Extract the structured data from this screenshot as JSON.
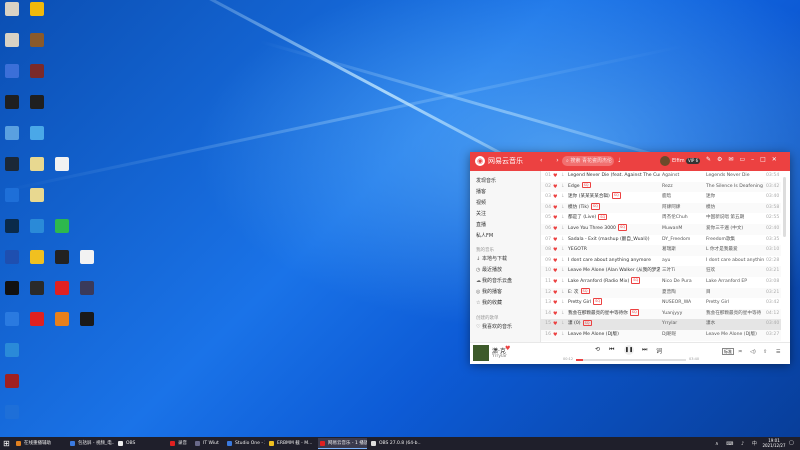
{
  "desktop": {
    "icons": [
      {
        "label": "",
        "color": "#d9d2c4"
      },
      {
        "label": "",
        "color": "#f0b90b"
      },
      {
        "label": "",
        "color": "#d9d2c4"
      },
      {
        "label": "",
        "color": "#8a5a2b"
      },
      {
        "label": "",
        "color": "#3b6fd8"
      },
      {
        "label": "",
        "color": "#7a2a2a"
      },
      {
        "label": "",
        "color": "#1f1f1f"
      },
      {
        "label": "",
        "color": "#1f1f1f"
      },
      {
        "label": "",
        "color": "#5aa0e0"
      },
      {
        "label": "",
        "color": "#4aa8e8"
      },
      {
        "label": "",
        "color": "#1b2838"
      },
      {
        "label": "",
        "color": "#e8d890"
      },
      {
        "label": "",
        "color": "#f2f2f2"
      },
      {
        "label": "",
        "color": "#1e6fd8"
      },
      {
        "label": "",
        "color": "#e8d890"
      },
      {
        "label": "",
        "color": "#0a2a4a"
      },
      {
        "label": "",
        "color": "#2a8ad8"
      },
      {
        "label": "",
        "color": "#2db84d"
      },
      {
        "label": "",
        "color": "#1e4fb0"
      },
      {
        "label": "",
        "color": "#f0c020"
      },
      {
        "label": "",
        "color": "#222222"
      },
      {
        "label": "",
        "color": "#f2f2f2"
      },
      {
        "label": "",
        "color": "#111111"
      },
      {
        "label": "",
        "color": "#2a2a2a"
      },
      {
        "label": "",
        "color": "#e02020"
      },
      {
        "label": "",
        "color": "#3a3a5a"
      },
      {
        "label": "",
        "color": "#2a7ae0"
      },
      {
        "label": "",
        "color": "#e02020"
      },
      {
        "label": "",
        "color": "#e8801a"
      },
      {
        "label": "",
        "color": "#1a1a1a"
      },
      {
        "label": "",
        "color": "#2a8ad8"
      },
      {
        "label": "",
        "color": "#a02020"
      },
      {
        "label": "",
        "color": "#1e6fd8"
      }
    ]
  },
  "app": {
    "title": "网易云音乐",
    "search_placeholder": "搜索 青花瓷周杰伦",
    "username": "Elfim",
    "vip": "VIP 6",
    "accent": "#ec4141",
    "sidebar": {
      "items": [
        "发现音乐",
        "播客",
        "视频",
        "关注",
        "直播",
        "私人FM"
      ],
      "section_mine": "我的音乐",
      "my_items": [
        {
          "icon": "download-icon",
          "glyph": "↓",
          "label": "本地与下载"
        },
        {
          "icon": "clock-icon",
          "glyph": "◷",
          "label": "最近播放"
        },
        {
          "icon": "cloud-icon",
          "glyph": "☁",
          "label": "我的音乐云盘"
        },
        {
          "icon": "podcast-icon",
          "glyph": "◎",
          "label": "我的播客"
        },
        {
          "icon": "star-icon",
          "glyph": "☆",
          "label": "我的收藏"
        }
      ],
      "section_playlists": "创建的歌单",
      "liked": "我喜欢的音乐"
    },
    "songs": [
      {
        "num": "01",
        "title": "Legend Never Die (feat. Against The Current)",
        "tag": "",
        "artist": "Against",
        "album": "Legends Never Die",
        "dur": "03:54"
      },
      {
        "num": "02",
        "title": "Edge",
        "tag": "SQ",
        "artist": "Rezz",
        "album": "The Silence Is Deafening",
        "dur": "03:42"
      },
      {
        "num": "03",
        "title": "迷你 (某某某某合辑)",
        "tag": "SQ",
        "artist": "鹿晗",
        "album": "迷你",
        "dur": "03:40"
      },
      {
        "num": "04",
        "title": "模仿 (Tik)",
        "tag": "SQ",
        "artist": "阿肆阿肆",
        "album": "模仿",
        "dur": "03:58"
      },
      {
        "num": "05",
        "title": "都是了 (Live)",
        "tag": "SQ",
        "artist": "周杰伦Chuh",
        "album": "中国新说唱 第五期",
        "dur": "02:55"
      },
      {
        "num": "06",
        "title": "Love You Three 3000",
        "tag": "SQ",
        "artist": "MuwanM",
        "album": "爱你三千遍 (中文)",
        "dur": "02:40"
      },
      {
        "num": "07",
        "title": "Sadala - Exit (mashup (翻自_Wuali))",
        "tag": "",
        "artist": "DY_Freedom",
        "album": "Freedom歌集",
        "dur": "03:35"
      },
      {
        "num": "08",
        "title": "YEGOTR",
        "tag": "",
        "artist": "葛瑞斯",
        "album": "L 你才是我最爱",
        "dur": "03:10"
      },
      {
        "num": "09",
        "title": "I dont care about anything anymore",
        "tag": "",
        "artist": "ayu",
        "album": "I dont care about anything a",
        "dur": "02:28"
      },
      {
        "num": "10",
        "title": "Leave Me Alone (Alan Walker (从我的梦游))",
        "tag": "",
        "artist": "三叶Ti",
        "album": "狂欢",
        "dur": "03:21"
      },
      {
        "num": "11",
        "title": "Lake Arranford (Radio Mix)",
        "tag": "SQ",
        "artist": "Nico De Pura",
        "album": "Lake Arranford EP",
        "dur": "03:08"
      },
      {
        "num": "12",
        "title": "E: 次",
        "tag": "SQ",
        "artist": "夏普陶",
        "album": "目",
        "dur": "03:21"
      },
      {
        "num": "13",
        "title": "Pretty Girl",
        "tag": "SQ",
        "artist": "NUSEOR_WA",
        "album": "Pretty Girl",
        "dur": "03:42"
      },
      {
        "num": "14",
        "title": "我会在那颗最亮的星中等待你",
        "tag": "SQ",
        "artist": "Yuanjyyy",
        "album": "我会在那颗最亮的星中等待",
        "dur": "04:12"
      },
      {
        "num": "15",
        "title": "潇 (0)",
        "tag": "SQ",
        "artist": "Yrrylar",
        "album": "潇水",
        "dur": "03:40"
      },
      {
        "num": "16",
        "title": "Leave Me Alone (DJ版)",
        "tag": "",
        "artist": "DJ呢呢",
        "album": "Leave Me Alone (DJ版)",
        "dur": "03:27"
      }
    ],
    "active_row": 14,
    "player": {
      "title": "潇·克",
      "artist": "Yrrylar",
      "current": "00:12",
      "total": "03:40",
      "progress": 0.06,
      "quality": "标准",
      "lyric": "词"
    }
  },
  "taskbar": {
    "start": "⊞",
    "apps": [
      {
        "label": "在线重播辅助",
        "color": "#e08020"
      },
      {
        "label": "包括屏 - 视频_电...",
        "color": "#3a7ae0"
      },
      {
        "label": "OBS",
        "color": "#eeeeee"
      },
      {
        "label": "录音",
        "color": "#e02020"
      },
      {
        "label": "IT Wiut",
        "color": "#6a6a8a"
      },
      {
        "label": "Studio One - 202...",
        "color": "#3a7ae0"
      },
      {
        "label": "ERBMM 截 - M...",
        "color": "#f0c020"
      },
      {
        "label": "网易云音乐 - 1 播放",
        "color": "#e02020"
      },
      {
        "label": "OBS 27.0.8 (64-b...",
        "color": "#dddddd"
      }
    ],
    "active_app": 7,
    "tray": "∧ ⌨ ♪ 中",
    "time": "19:01",
    "date": "2021/12/27"
  }
}
